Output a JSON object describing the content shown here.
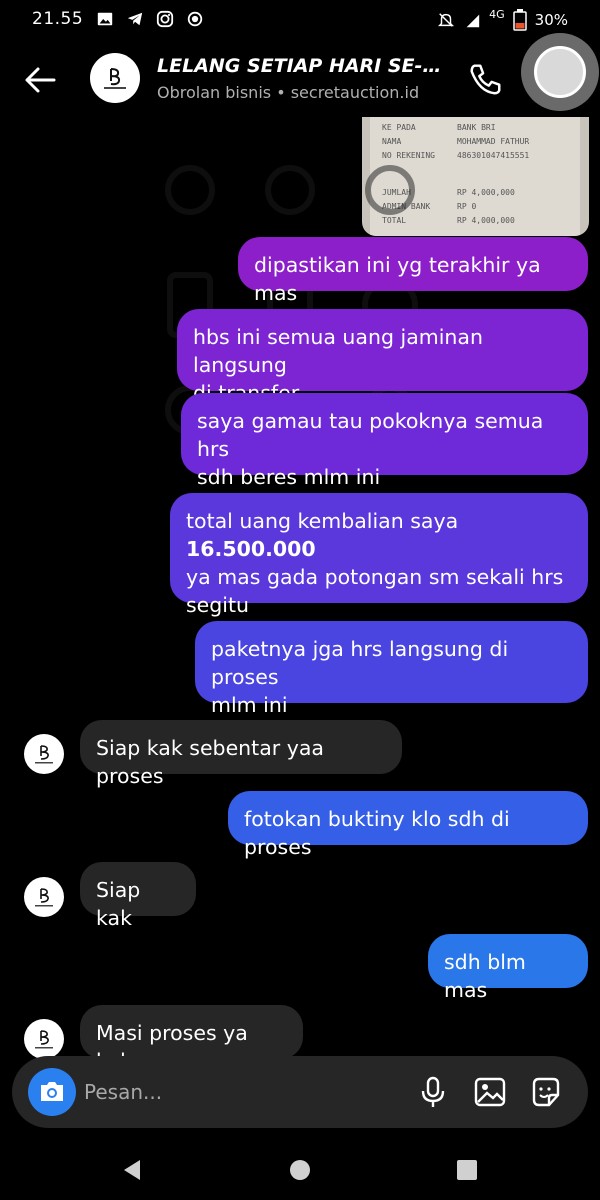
{
  "status_bar": {
    "time": "21.55",
    "network": "4G",
    "battery": "30%",
    "icons": [
      "gallery-icon",
      "telegram-icon",
      "instagram-icon",
      "record-icon",
      "mute-icon",
      "signal-icon",
      "battery-icon"
    ]
  },
  "header": {
    "title": "LELANG SETIAP HARI SE-IN...",
    "subtitle": "Obrolan bisnis • secretauction.id",
    "icons": [
      "back-arrow-icon",
      "call-icon"
    ]
  },
  "messages": [
    {
      "side": "out",
      "lines": [
        "dipastikan ini yg terakhir ya mas"
      ],
      "color": "#8c1fc9"
    },
    {
      "side": "out",
      "lines": [
        "hbs ini semua uang jaminan langsung",
        "di transfer"
      ],
      "color": "#7d25d3"
    },
    {
      "side": "out",
      "lines": [
        "saya gamau tau pokoknya semua hrs",
        "sdh beres mlm ini"
      ],
      "color": "#6e2ad8"
    },
    {
      "side": "out",
      "line1_pre": "total uang kembalian saya ",
      "line1_bold": "16.500.000",
      "lines_rest": [
        "ya mas gada potongan sm sekali hrs",
        "segitu"
      ],
      "color": "#5a38dc"
    },
    {
      "side": "out",
      "lines": [
        "paketnya jga hrs langsung di proses",
        "mlm ini"
      ],
      "color": "#4a44e0"
    },
    {
      "side": "in",
      "lines": [
        "Siap kak sebentar yaa proses"
      ]
    },
    {
      "side": "out",
      "lines": [
        "fotokan buktiny klo sdh di proses"
      ],
      "color": "#355fe6"
    },
    {
      "side": "in",
      "lines": [
        "Siap kak"
      ]
    },
    {
      "side": "out",
      "lines": [
        "sdh blm mas"
      ],
      "color": "#2a77ea"
    },
    {
      "side": "in",
      "lines": [
        "Masi proses ya kak"
      ]
    }
  ],
  "receipt_text": [
    [
      "KE PADA",
      "BANK BRI"
    ],
    [
      "NAMA",
      "MOHAMMAD FATHUR"
    ],
    [
      "NO REKENING",
      "486301047415551"
    ],
    [
      "JUMLAH",
      "RP 4,000,000"
    ],
    [
      "ADMIN BANK",
      "RP 0"
    ],
    [
      "TOTAL",
      "RP 4,000,000"
    ]
  ],
  "composer": {
    "placeholder": "Pesan...",
    "icons": [
      "camera-icon",
      "microphone-icon",
      "gallery-icon",
      "sticker-icon"
    ]
  },
  "nav_bar": {
    "icons": [
      "nav-back-icon",
      "nav-home-icon",
      "nav-recents-icon"
    ]
  },
  "colors": {
    "background": "#000000",
    "incoming_bubble": "#262626",
    "camera_button": "#2b80f0"
  }
}
